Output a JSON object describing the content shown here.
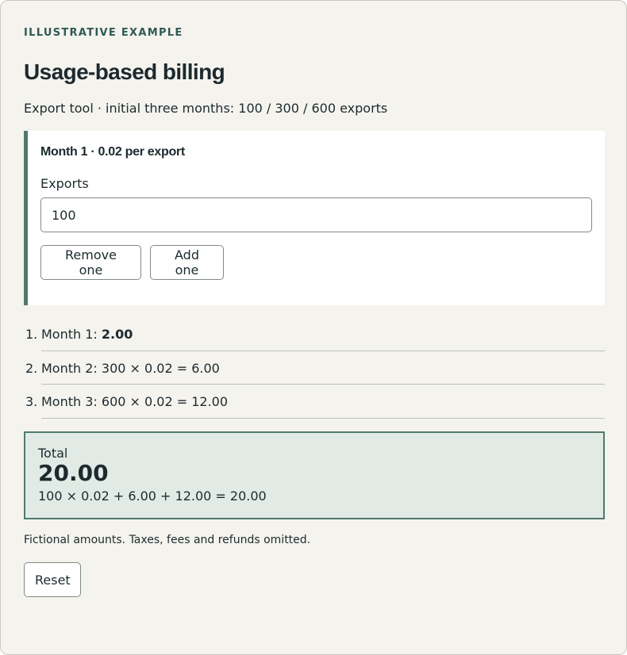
{
  "eyebrow": "ILLUSTRATIVE EXAMPLE",
  "title": "Usage-based billing",
  "subtitle": "Export tool · initial three months: 100 / 300 / 600 exports",
  "panel": {
    "heading": "Month 1 · 0.02 per export",
    "field_label": "Exports",
    "exports_value": "100",
    "remove_label": "Remove one",
    "add_label": "Add one"
  },
  "months": [
    {
      "num": "1.",
      "label": "Month 1: ",
      "value": "2.00"
    },
    {
      "num": "2.",
      "label": "Month 2: 300 × 0.02 = 6.00",
      "value": ""
    },
    {
      "num": "3.",
      "label": "Month 3: 600 × 0.02 = 12.00",
      "value": ""
    }
  ],
  "total": {
    "label": "Total",
    "value": "20.00",
    "formula": "100 × 0.02 + 6.00 + 12.00 = 20.00"
  },
  "footnote": "Fictional amounts. Taxes, fees and refunds omitted.",
  "reset_label": "Reset",
  "colors": {
    "accent": "#4f7a6e",
    "background": "#f5f3ee",
    "total_background": "#e1eae5",
    "text": "#1c2a2e"
  }
}
